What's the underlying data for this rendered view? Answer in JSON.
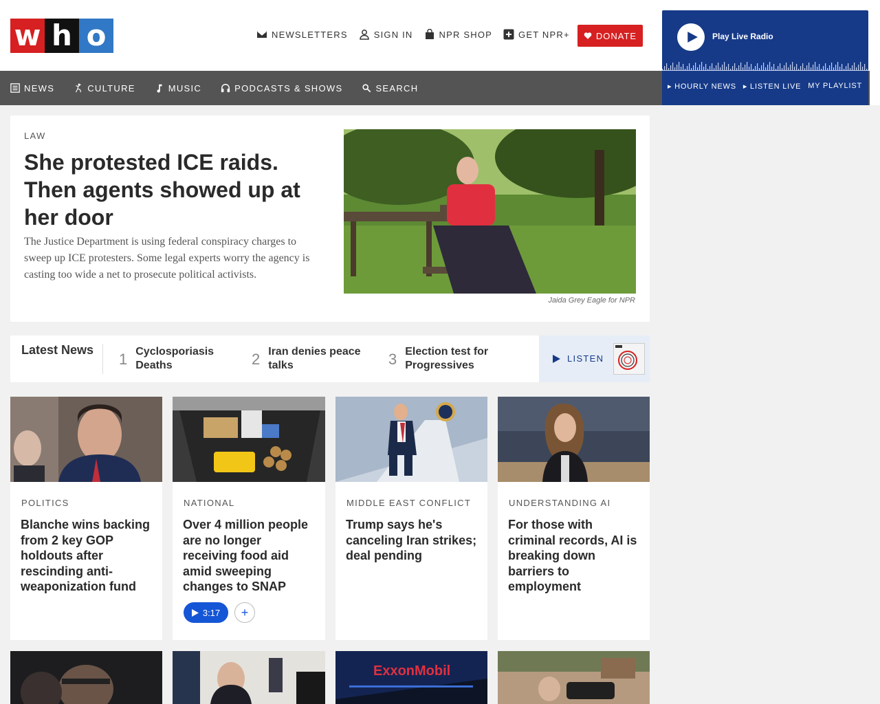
{
  "brand": {
    "logo_letters": [
      "w",
      "h",
      "o"
    ]
  },
  "utility_nav": [
    {
      "label": "NEWSLETTERS",
      "icon": "mail-icon"
    },
    {
      "label": "SIGN IN",
      "icon": "user-icon"
    },
    {
      "label": "NPR SHOP",
      "icon": "shopping-bag-icon"
    },
    {
      "label": "GET NPR+",
      "icon": "plus-square-icon"
    }
  ],
  "donate": {
    "label": "DONATE",
    "icon": "heart-icon"
  },
  "radio": {
    "title": "Play Live Radio",
    "links": [
      "▸ HOURLY NEWS",
      "▸ LISTEN LIVE",
      "MY PLAYLIST"
    ]
  },
  "main_nav": [
    {
      "label": "NEWS",
      "icon": "newspaper-icon"
    },
    {
      "label": "CULTURE",
      "icon": "dancer-icon"
    },
    {
      "label": "MUSIC",
      "icon": "music-note-icon"
    },
    {
      "label": "PODCASTS & SHOWS",
      "icon": "headphones-icon"
    },
    {
      "label": "SEARCH",
      "icon": "search-icon"
    }
  ],
  "hero": {
    "slug": "LAW",
    "title": "She protested ICE raids. Then agents showed up at her door",
    "teaser": "The Justice Department is using federal conspiracy charges to sweep up ICE protesters. Some legal experts worry the agency is casting too wide a net to prosecute political activists.",
    "credit": "Jaida Grey Eagle for NPR"
  },
  "latest": {
    "label": "Latest News",
    "items": [
      {
        "num": "1",
        "text": "Cyclosporiasis Deaths"
      },
      {
        "num": "2",
        "text": "Iran denies peace talks"
      },
      {
        "num": "3",
        "text": "Election test for Progressives"
      }
    ],
    "listen_label": "LISTEN"
  },
  "cards": [
    {
      "slug": "POLITICS",
      "title": "Blanche wins backing from 2 key GOP holdouts after rescinding anti-weaponization fund"
    },
    {
      "slug": "NATIONAL",
      "title": "Over 4 million people are no longer receiving food aid amid sweeping changes to SNAP",
      "audio": "3:17",
      "add": "+"
    },
    {
      "slug": "MIDDLE EAST CONFLICT",
      "title": "Trump says he's canceling Iran strikes; deal pending"
    },
    {
      "slug": "UNDERSTANDING AI",
      "title": "For those with criminal records, AI is breaking down barriers to employment"
    }
  ],
  "colors": {
    "accent_red": "#d62021",
    "radio_blue": "#163a88",
    "nav_gray": "#545454",
    "audio_blue": "#1556d6"
  }
}
